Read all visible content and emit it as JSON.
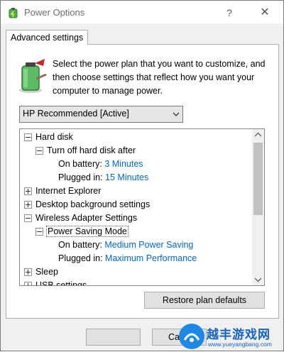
{
  "window": {
    "title": "Power Options",
    "help_symbol": "?",
    "close_symbol": "✕"
  },
  "tab": {
    "label": "Advanced settings"
  },
  "description": "Select the power plan that you want to customize, and then choose settings that reflect how you want your computer to manage power.",
  "plan_dropdown": {
    "selected": "HP Recommended [Active]"
  },
  "tree": [
    {
      "label": "Hard disk",
      "value": "",
      "toggle": "minus"
    },
    {
      "label": "Turn off hard disk after",
      "value": "",
      "toggle": "minus"
    },
    {
      "label": "On battery:",
      "value": "3 Minutes",
      "toggle": "none"
    },
    {
      "label": "Plugged in:",
      "value": "15 Minutes",
      "toggle": "none"
    },
    {
      "label": "Internet Explorer",
      "value": "",
      "toggle": "plus"
    },
    {
      "label": "Desktop background settings",
      "value": "",
      "toggle": "plus"
    },
    {
      "label": "Wireless Adapter Settings",
      "value": "",
      "toggle": "minus"
    },
    {
      "label": "Power Saving Mode",
      "value": "",
      "toggle": "minus"
    },
    {
      "label": "On battery:",
      "value": "Medium Power Saving",
      "toggle": "none"
    },
    {
      "label": "Plugged in:",
      "value": "Maximum Performance",
      "toggle": "none"
    },
    {
      "label": "Sleep",
      "value": "",
      "toggle": "plus"
    },
    {
      "label": "USB settings",
      "value": "",
      "toggle": "plus"
    }
  ],
  "buttons": {
    "restore_label": "Restore plan defaults",
    "cancel_label": "Ca"
  },
  "watermark": {
    "brand": "越丰游戏网",
    "url": "www.yueyangbang.com"
  },
  "icons": {
    "app": "power-options-icon",
    "battery": "battery-power-plan-icon",
    "dropdown": "chevron-down-icon",
    "scroll_up": "scroll-up-arrow-icon",
    "scroll_down": "scroll-down-arrow-icon",
    "watermark": "watermark-logo-icon"
  },
  "colors": {
    "setting_value": "#0066cc",
    "accent": "#0078d7"
  }
}
